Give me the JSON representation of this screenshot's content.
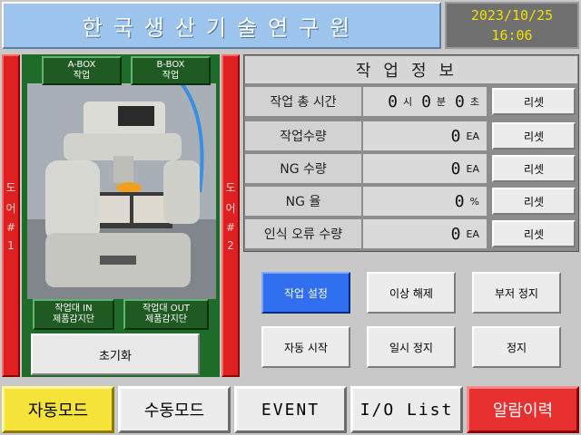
{
  "header": {
    "title": "한국생산기술연구원",
    "date": "2023/10/25",
    "time": "16:06"
  },
  "doors": {
    "left": [
      "도",
      "어",
      "#",
      "1"
    ],
    "right": [
      "도",
      "어",
      "#",
      "2"
    ]
  },
  "camera": {
    "a_box": [
      "A-BOX",
      "작업"
    ],
    "b_box": [
      "B-BOX",
      "작업"
    ],
    "in_sensor": [
      "작업대 IN",
      "제품감지단"
    ],
    "out_sensor": [
      "작업대 OUT",
      "제품감지단"
    ],
    "init_label": "초기화"
  },
  "info": {
    "title": "작업정보",
    "rows": [
      {
        "label": "작업 총 시간",
        "reset": "리셋"
      },
      {
        "label": "작업수량",
        "value": "0",
        "unit": "EA",
        "reset": "리셋"
      },
      {
        "label": "NG 수량",
        "value": "0",
        "unit": "EA",
        "reset": "리셋"
      },
      {
        "label": "NG 율",
        "value": "0",
        "unit": "%",
        "reset": "리셋"
      },
      {
        "label": "인식 오류 수량",
        "value": "0",
        "unit": "EA",
        "reset": "리셋"
      }
    ],
    "time": {
      "h": "0",
      "h_unit": "시",
      "m": "0",
      "m_unit": "분",
      "s": "0",
      "s_unit": "초"
    }
  },
  "controls": {
    "work_setting": "작업 설정",
    "fault_clear": "이상 해제",
    "buzzer_stop": "부저 정지",
    "auto_start": "자동 시작",
    "pause": "일시 정지",
    "stop": "정지"
  },
  "tabs": {
    "auto_mode": "자동모드",
    "manual_mode": "수동모드",
    "event": "EVENT",
    "io_list": "I/O List",
    "alarm_history": "알람이력"
  },
  "colors": {
    "accent_active": "#2f6ff0",
    "alarm": "#e83030",
    "auto_mode": "#f5e33a",
    "door": "#e02020"
  }
}
